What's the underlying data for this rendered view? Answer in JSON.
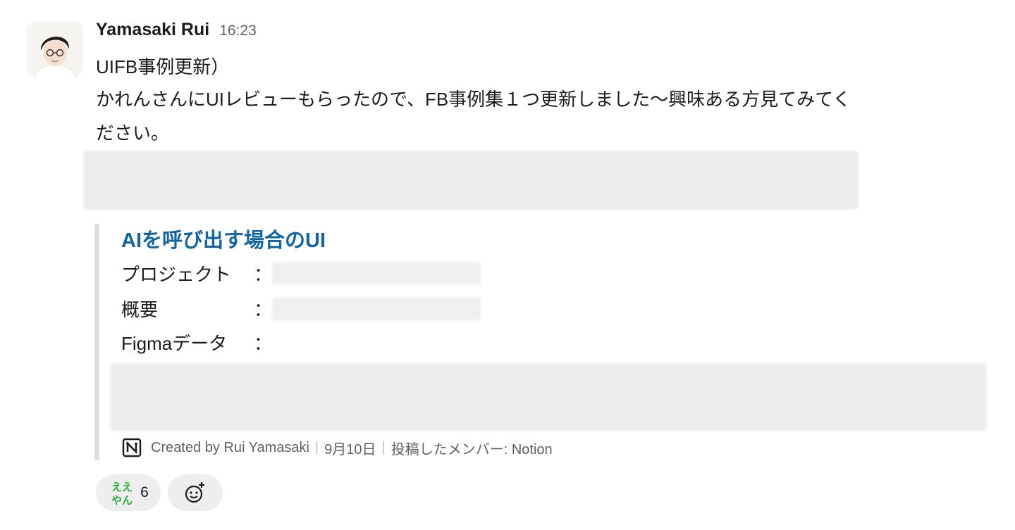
{
  "message": {
    "author": "Yamasaki Rui",
    "timestamp": "16:23",
    "lines": [
      "UIFB事例更新）",
      "かれんさんにUIレビューもらったので、FB事例集１つ更新しました〜興味ある方見てみてく",
      "ださい。"
    ]
  },
  "attachment": {
    "title": "AIを呼び出す場合のUI",
    "fields": [
      {
        "label": "プロジェクト",
        "colon": "："
      },
      {
        "label": "概要",
        "colon": "："
      },
      {
        "label": "Figmaデータ",
        "colon": "："
      }
    ],
    "footer": {
      "created_by": "Created by Rui Yamasaki",
      "separator": "|",
      "date": "9月10日",
      "posted_by": "投稿したメンバー: Notion"
    }
  },
  "reactions": [
    {
      "emoji": "ええやん-icon",
      "emoji_text": [
        "ええ",
        "やん"
      ],
      "count": "6"
    }
  ],
  "icons": {
    "avatar": "avatar",
    "notion": "notion-icon",
    "add_reaction": "add-reaction-icon"
  },
  "colors": {
    "link": "#1264a3",
    "text": "#1d1c1d",
    "muted": "#616061",
    "reaction_bg": "#eeeeee",
    "emoji_green": "#2bac3e"
  }
}
